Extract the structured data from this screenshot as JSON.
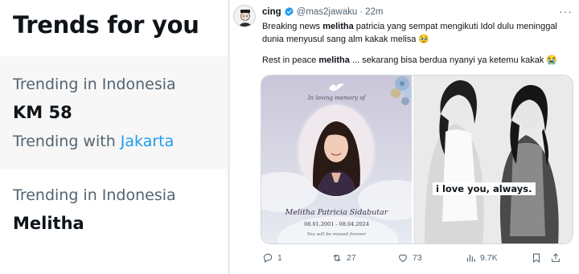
{
  "trends": {
    "title": "Trends for you",
    "items": [
      {
        "context": "Trending in Indonesia",
        "name": "KM 58",
        "with_prefix": "Trending with",
        "with_link": "Jakarta"
      },
      {
        "context": "Trending in Indonesia",
        "name": "Melitha"
      }
    ]
  },
  "tweet": {
    "display_name": "cing",
    "handle": "@mas2jawaku",
    "separator": "·",
    "time": "22m",
    "more": "···",
    "paragraph1": {
      "before": "Breaking news ",
      "bold": "melitha",
      "after": " patricia yang sempat mengikuti Idol dulu meninggal dunia menyusul sang alm kakak melisa 🥹"
    },
    "paragraph2": {
      "before": "Rest in peace ",
      "bold": "melitha",
      "after": " ... sekarang bisa berdua nyanyi ya ketemu kakak 😭"
    },
    "card": {
      "memory_text": "In loving memory of",
      "name": "Melitha Patricia Sidabutar",
      "dates": "08.01.2001 - 08.04.2024",
      "missed_text": "You will be missed forever"
    },
    "photo_caption": "i love you, always.",
    "actions": {
      "replies": "1",
      "reposts": "27",
      "likes": "73",
      "views": "9.7K"
    }
  },
  "colors": {
    "text": "#0f1419",
    "muted": "#536471",
    "link": "#1d9bf0",
    "verified": "#1d9bf0",
    "highlight_bg": "#f7f7f7"
  }
}
